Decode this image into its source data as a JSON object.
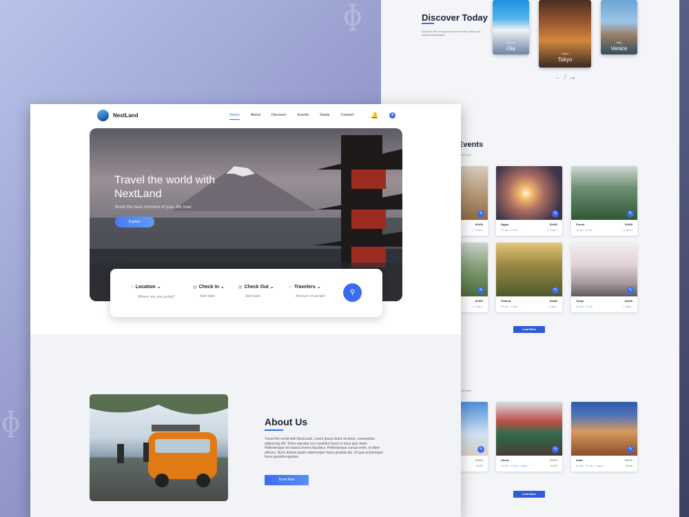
{
  "discover": {
    "title": "Discover Today",
    "subtitle": "Discover the best places from modern cities and natural landscapes",
    "cards": [
      {
        "small": "Greece",
        "name": "Oia"
      },
      {
        "small": "Japan",
        "name": "Tokyo"
      },
      {
        "small": "Italy",
        "name": "Venice"
      }
    ],
    "arrow_left": "←",
    "arrow_sep": "/",
    "arrow_right": "→"
  },
  "events": {
    "title": "Events",
    "subtitle": "of the year",
    "cards": [
      {
        "name": "",
        "price": "$1400",
        "date": "",
        "days": "( 7 days )"
      },
      {
        "name": "Egypt",
        "price": "$1400",
        "date": "15 Jan - 21 Jan",
        "days": "( 7 days )"
      },
      {
        "name": "Forest",
        "price": "$1400",
        "date": "15 Jan - 21 Jan",
        "days": "( 7 days )"
      },
      {
        "name": "",
        "price": "$1400",
        "date": "",
        "days": "( 7 days )"
      },
      {
        "name": "Finland",
        "price": "$1400",
        "date": "15 Jan - 21 Jan",
        "days": "( 7 days )"
      },
      {
        "name": "Tokyo",
        "price": "$1400",
        "date": "15 Jan - 21 Jan",
        "days": "( 7 days )"
      }
    ],
    "load_more": "Load More"
  },
  "deals": {
    "subtitle": "of the year",
    "cards": [
      {
        "name": "",
        "old": "$1400",
        "price": "$1400",
        "date": ""
      },
      {
        "name": "China",
        "old": "$1600",
        "price": "$1400",
        "date": "15 Jan - 21 Jan ( 7 days )"
      },
      {
        "name": "India",
        "old": "$1600",
        "price": "$1200",
        "date": "15 Jan - 21 Jan ( 7 days )"
      }
    ],
    "load_more": "Load More"
  },
  "nav": {
    "brand": "NextLand",
    "items": [
      "Home",
      "About",
      "Discover",
      "Events",
      "Deals",
      "Contact"
    ]
  },
  "hero": {
    "title": "Travel the world with NextLand",
    "subtitle": "Book the best moment of your life now",
    "cta": "Explore"
  },
  "search": {
    "location_label": "Location",
    "location_value": "Where are you going?",
    "checkin_label": "Check In",
    "checkin_value": "Add date",
    "checkout_label": "Check Out",
    "checkout_value": "Add date",
    "travelers_label": "Travelers",
    "travelers_value": "Amount of people"
  },
  "about": {
    "title": "About Us",
    "text": "Travel the world with NextLand. Lorem ipsum dolor sit amet, consectetur adipiscing elit. Tortor egestas orci curabitur fusce in risus quis amet. Pellentesque sit massa viverra faucibus. Pellentesque cursus enim, in diam ultrices. Nunc dictum quam ullamcorper fusce gravida dui. Ut quis scelerisque fusce gravida egestas.",
    "cta": "Book Now"
  },
  "colors": {
    "accent": "#3b6bf0",
    "dark": "#1b1f33"
  }
}
